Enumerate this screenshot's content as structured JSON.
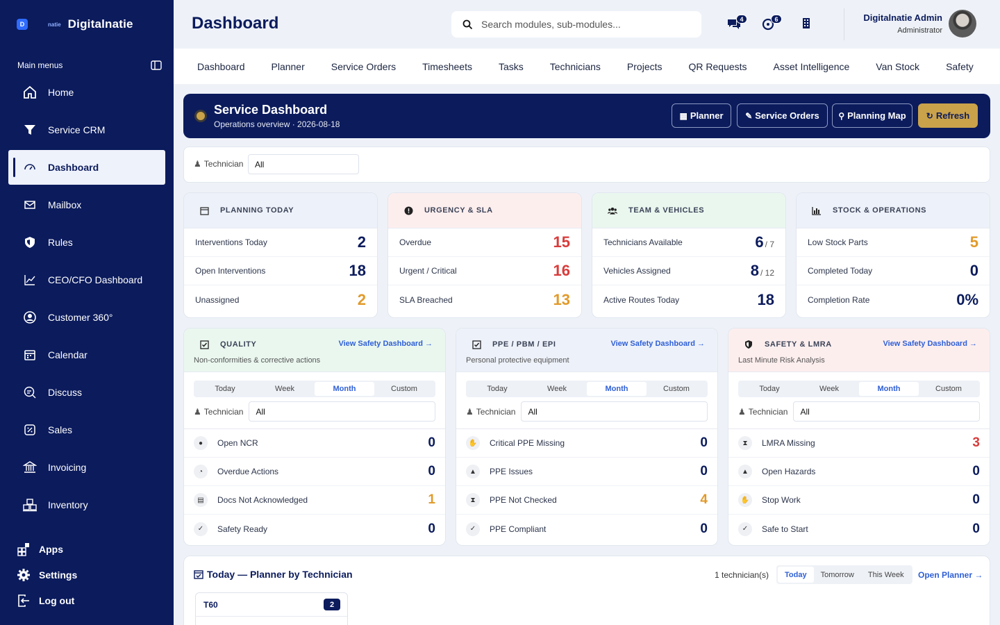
{
  "brand": {
    "logo_letter": "D",
    "small": "natie",
    "name": "Digitalnatie"
  },
  "sidebar": {
    "menu_label": "Main menus",
    "items": [
      {
        "label": "Home",
        "icon": "home-icon"
      },
      {
        "label": "Service CRM",
        "icon": "funnel-icon"
      },
      {
        "label": "Dashboard",
        "icon": "gauge-icon",
        "active": true
      },
      {
        "label": "Mailbox",
        "icon": "mail-icon"
      },
      {
        "label": "Rules",
        "icon": "shield-icon"
      },
      {
        "label": "CEO/CFO Dashboard",
        "icon": "chart-line-icon"
      },
      {
        "label": "Customer 360°",
        "icon": "user-circle-icon"
      },
      {
        "label": "Calendar",
        "icon": "calendar-icon"
      },
      {
        "label": "Discuss",
        "icon": "chat-icon"
      },
      {
        "label": "Sales",
        "icon": "percent-icon"
      },
      {
        "label": "Invoicing",
        "icon": "bank-icon"
      },
      {
        "label": "Inventory",
        "icon": "boxes-icon"
      }
    ],
    "bottom": [
      {
        "label": "Apps",
        "icon": "apps-icon"
      },
      {
        "label": "Settings",
        "icon": "gear-icon"
      },
      {
        "label": "Log out",
        "icon": "logout-icon"
      }
    ]
  },
  "header": {
    "title": "Dashboard",
    "search_placeholder": "Search modules, sub-modules...",
    "messages_badge": "4",
    "notifications_badge": "6",
    "user_name": "Digitalnatie Admin",
    "user_role": "Administrator"
  },
  "topnav": [
    "Dashboard",
    "Planner",
    "Service Orders",
    "Timesheets",
    "Tasks",
    "Technicians",
    "Projects",
    "QR Requests",
    "Asset Intelligence",
    "Van Stock",
    "Safety"
  ],
  "banner": {
    "title": "Service Dashboard",
    "subtitle": "Operations overview · 2026-08-18",
    "buttons": {
      "planner": "Planner",
      "service_orders": "Service Orders",
      "planning_map": "Planning Map",
      "refresh": "Refresh"
    }
  },
  "filter": {
    "label": "Technician",
    "value": "All"
  },
  "stat_cards": [
    {
      "title": "PLANNING TODAY",
      "rows": [
        {
          "label": "Interventions Today",
          "value": "2"
        },
        {
          "label": "Open Interventions",
          "value": "18"
        },
        {
          "label": "Unassigned",
          "value": "2"
        }
      ]
    },
    {
      "title": "URGENCY & SLA",
      "rows": [
        {
          "label": "Overdue",
          "value": "15"
        },
        {
          "label": "Urgent / Critical",
          "value": "16"
        },
        {
          "label": "SLA Breached",
          "value": "13"
        }
      ]
    },
    {
      "title": "TEAM & VEHICLES",
      "rows": [
        {
          "label": "Technicians Available",
          "value": "6",
          "total": "/ 7"
        },
        {
          "label": "Vehicles Assigned",
          "value": "8",
          "total": "/ 12"
        },
        {
          "label": "Active Routes Today",
          "value": "18"
        }
      ]
    },
    {
      "title": "STOCK & OPERATIONS",
      "rows": [
        {
          "label": "Low Stock Parts",
          "value": "5"
        },
        {
          "label": "Completed Today",
          "value": "0"
        },
        {
          "label": "Completion Rate",
          "value": "0%"
        }
      ]
    }
  ],
  "safety_cards": [
    {
      "title": "QUALITY",
      "subtitle": "Non-conformities & corrective actions",
      "link": "View Safety Dashboard →",
      "rows": [
        {
          "label": "Open NCR",
          "value": "0"
        },
        {
          "label": "Overdue Actions",
          "value": "0"
        },
        {
          "label": "Docs Not Acknowledged",
          "value": "1"
        },
        {
          "label": "Safety Ready",
          "value": "0"
        }
      ]
    },
    {
      "title": "PPE / PBM / EPI",
      "subtitle": "Personal protective equipment",
      "link": "View Safety Dashboard →",
      "rows": [
        {
          "label": "Critical PPE Missing",
          "value": "0"
        },
        {
          "label": "PPE Issues",
          "value": "0"
        },
        {
          "label": "PPE Not Checked",
          "value": "4"
        },
        {
          "label": "PPE Compliant",
          "value": "0"
        }
      ]
    },
    {
      "title": "SAFETY & LMRA",
      "subtitle": "Last Minute Risk Analysis",
      "link": "View Safety Dashboard →",
      "rows": [
        {
          "label": "LMRA Missing",
          "value": "3"
        },
        {
          "label": "Open Hazards",
          "value": "0"
        },
        {
          "label": "Stop Work",
          "value": "0"
        },
        {
          "label": "Safe to Start",
          "value": "0"
        }
      ]
    }
  ],
  "period_tabs": [
    "Today",
    "Week",
    "Month",
    "Custom"
  ],
  "planner": {
    "title": "Today — Planner by Technician",
    "count": "1 technician(s)",
    "tabs": [
      "Today",
      "Tomorrow",
      "This Week"
    ],
    "open": "Open Planner →",
    "tech": {
      "name": "T60",
      "count": "2"
    }
  },
  "colors": {
    "navy": "#0b1b5c",
    "gold": "#c9a24a",
    "red": "#d93b3b",
    "orange": "#e19a2b",
    "link": "#2f5fd6"
  }
}
